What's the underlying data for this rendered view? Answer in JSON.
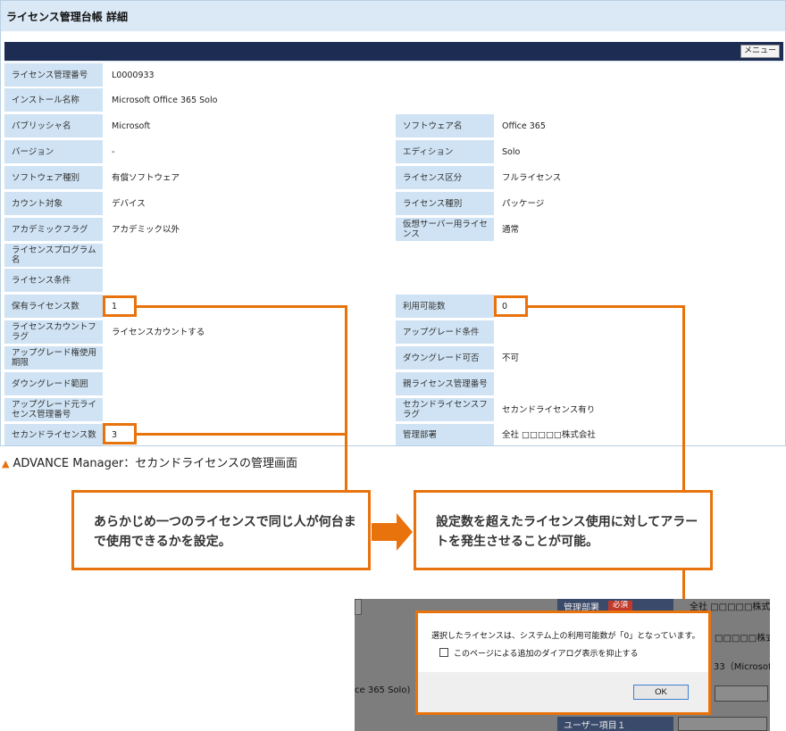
{
  "title": "ライセンス管理台帳 詳細",
  "menu_label": "メニュー",
  "rows_left": [
    {
      "label": "ライセンス管理番号",
      "value": "L0000933"
    },
    {
      "label": "インストール名称",
      "value": "Microsoft Office 365 Solo"
    },
    {
      "label": "パブリッシャ名",
      "value": "Microsoft"
    },
    {
      "label": "バージョン",
      "value": "-"
    },
    {
      "label": "ソフトウェア種別",
      "value": "有償ソフトウェア"
    },
    {
      "label": "カウント対象",
      "value": "デバイス"
    },
    {
      "label": "アカデミックフラグ",
      "value": "アカデミック以外"
    },
    {
      "label": "ライセンスプログラム名",
      "value": ""
    },
    {
      "label": "ライセンス条件",
      "value": ""
    },
    {
      "label": "保有ライセンス数",
      "value": "1"
    },
    {
      "label": "ライセンスカウントフラグ",
      "value": "ライセンスカウントする"
    },
    {
      "label": "アップグレード権使用期限",
      "value": ""
    },
    {
      "label": "ダウングレード範囲",
      "value": ""
    },
    {
      "label": "アップグレード元ライセンス管理番号",
      "value": ""
    },
    {
      "label": "セカンドライセンス数",
      "value": "3"
    }
  ],
  "rows_right": [
    {
      "label": "ソフトウェア名",
      "value": "Office 365"
    },
    {
      "label": "エディション",
      "value": "Solo"
    },
    {
      "label": "ライセンス区分",
      "value": "フルライセンス"
    },
    {
      "label": "ライセンス種別",
      "value": "パッケージ"
    },
    {
      "label": "仮想サーバー用ライセンス",
      "value": "通常"
    },
    {
      "label": "利用可能数",
      "value": "0"
    },
    {
      "label": "アップグレード条件",
      "value": ""
    },
    {
      "label": "ダウングレード可否",
      "value": "不可"
    },
    {
      "label": "親ライセンス管理番号",
      "value": ""
    },
    {
      "label": "セカンドライセンスフラグ",
      "value": "セカンドライセンス有り"
    },
    {
      "label": "管理部署",
      "value": "全社 □□□□□株式会社"
    }
  ],
  "caption": "ADVANCE Manager：セカンドライセンスの管理画面",
  "caption_marker": "▲",
  "callout_left": "あらかじめ一つのライセンスで同じ人が何台まで使用できるかを設定。",
  "callout_right": "設定数を超えたライセンス使用に対してアラートを発生させることが可能。",
  "crop": {
    "dept_label": "管理部署",
    "required_badge": "必須",
    "bg_text_1": "全社 □□□□□株式",
    "bg_text_2": "□□□□□株式",
    "bg_text_3": "33（Microsoft",
    "bg_text_4": "ce 365 Solo)",
    "user_item": "ユーザー項目１"
  },
  "dialog": {
    "message": "選択したライセンスは、システム上の利用可能数が「0」となっています。",
    "checkbox_label": "このページによる追加のダイアログ表示を抑止する",
    "ok_label": "OK"
  },
  "colors": {
    "accent": "#e8720c",
    "navy": "#1c2c52",
    "label_bg": "#cfe3f4",
    "title_bg": "#dbe9f6"
  }
}
